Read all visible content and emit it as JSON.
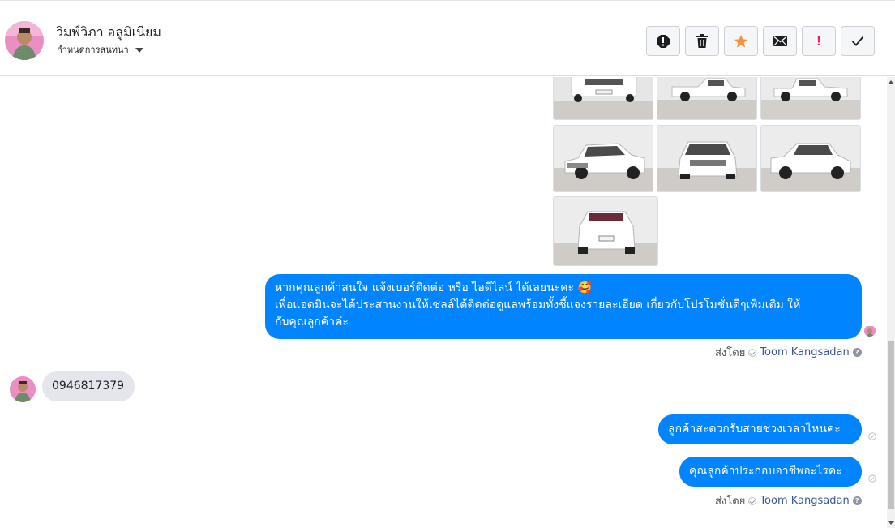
{
  "header": {
    "contact_name": "วิมพ์วิภา อลูมิเนียม",
    "assign_label": "กำหนดการสนทนา",
    "action_icons": [
      "alert-icon",
      "trash-icon",
      "star-icon",
      "envelope-icon",
      "exclamation-icon",
      "check-icon"
    ],
    "exclamation_text": "!"
  },
  "colors": {
    "outgoing_bubble": "#0084ff",
    "incoming_bubble": "#e4e6eb",
    "star": "#f7923b",
    "exclamation": "#e0245e",
    "link": "#385898"
  },
  "messages": {
    "photos_count_visible": 7,
    "outgoing_1_line1": "หากคุณลูกค้าสนใจ แจ้งเบอร์ติดต่อ หรือ ไอดีไลน์ ได้เลยนะคะ 🥰",
    "outgoing_1_line2": "เพื่อแอดมินจะได้ประสานงานให้เซลล์ได้ติดต่อดูแลพร้อมทั้งชี้แจงรายละเอียด เกี่ยวกับโปรโมชั่นดีๆเพิ่มเติม ให้",
    "outgoing_1_line3": "กับคุณลูกค้าค่ะ",
    "incoming_1": "0946817379",
    "outgoing_2": "ลูกค้าสะดวกรับสายช่วงเวลาไหนคะ",
    "outgoing_3": "คุณลูกค้าประกอบอาชีพอะไรคะ"
  },
  "sent_by": {
    "prefix": "ส่งโดย",
    "agent": "Toom Kangsadan",
    "help": "?"
  }
}
